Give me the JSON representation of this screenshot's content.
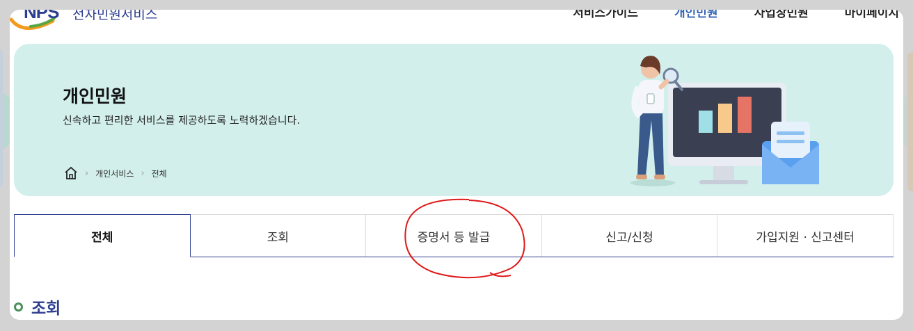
{
  "header": {
    "logo_mark": "NPS",
    "site_title": "전자민원서비스",
    "nav": [
      {
        "label": "서비스가이드",
        "active": false
      },
      {
        "label": "개인민원",
        "active": true
      },
      {
        "label": "사업장민원",
        "active": false
      },
      {
        "label": "마이페이지",
        "active": false
      }
    ]
  },
  "hero": {
    "title": "개인민원",
    "description": "신속하고 편리한 서비스를 제공하도록 노력하겠습니다.",
    "breadcrumb": [
      "개인서비스",
      "전체"
    ]
  },
  "tabs": [
    {
      "label": "전체",
      "active": true
    },
    {
      "label": "조회",
      "active": false
    },
    {
      "label": "증명서 등 발급",
      "active": false
    },
    {
      "label": "신고/신청",
      "active": false
    },
    {
      "label": "가입지원 · 신고센터",
      "active": false
    }
  ],
  "section": {
    "title": "조회"
  },
  "colors": {
    "brand": "#2d3d8f",
    "accent": "#3464b4",
    "hero_bg": "#d2efec",
    "annotation": "#e01818"
  }
}
